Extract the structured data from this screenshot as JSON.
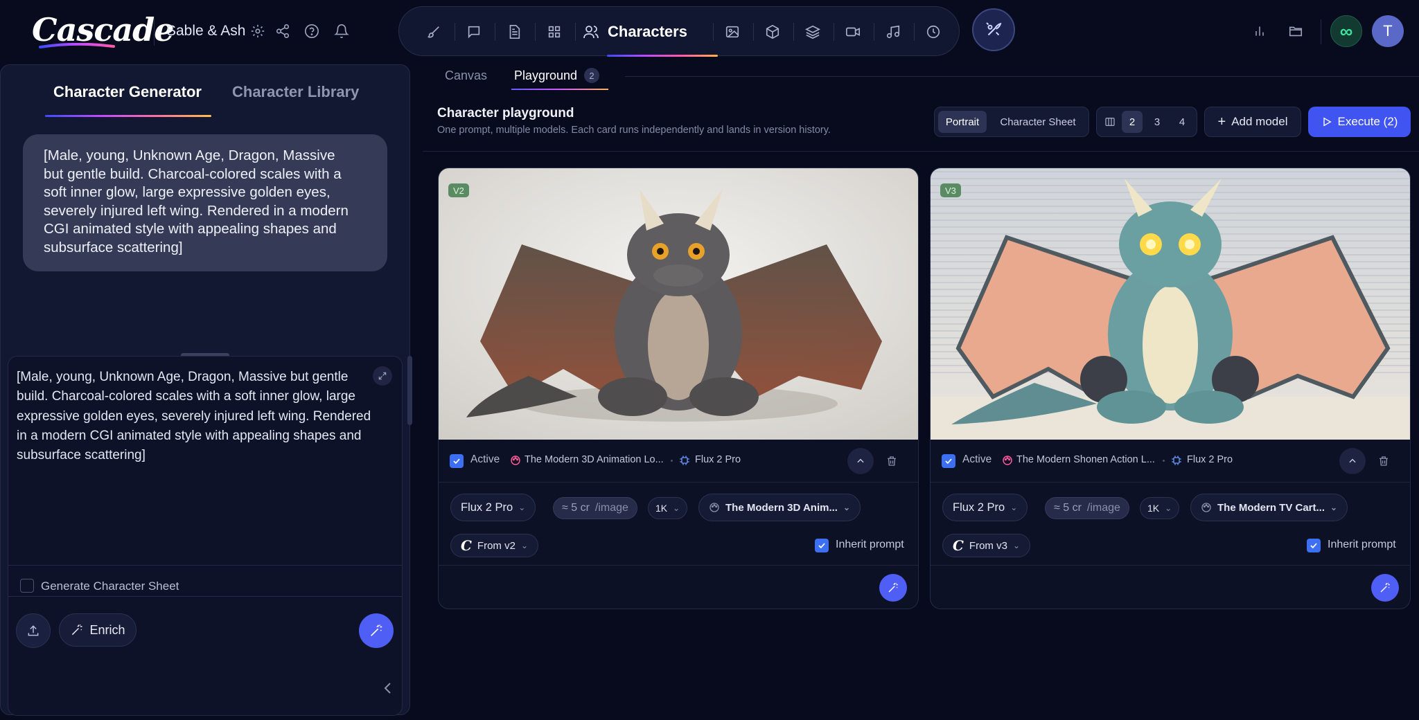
{
  "app": {
    "logo": "Cascade",
    "project_name": "Sable & Ash"
  },
  "nav": {
    "active_label": "Characters",
    "items": [
      "brush-icon",
      "chat-icon",
      "document-icon",
      "grid-icon",
      "users-icon",
      "image-icon",
      "cube-icon",
      "layers-icon",
      "video-icon",
      "music-icon",
      "history-icon"
    ]
  },
  "left_panel": {
    "tabs": [
      "Character Generator",
      "Character Library"
    ],
    "active_tab": 0,
    "bubble_lines": [
      "[Male, young, Unknown Age, Dragon, Massive",
      "but gentle build. Charcoal-colored scales with a",
      "soft inner glow, large expressive golden eyes,",
      "severely injured left wing. Rendered in a modern",
      "CGI animated style with appealing shapes and",
      "subsurface scattering]"
    ],
    "prompt_lines": [
      "[Male, young, Unknown Age, Dragon, Massive but gentle",
      "build. Charcoal-colored scales with a soft inner glow, large",
      "expressive golden eyes, severely injured left wing. Rendered",
      "in a modern CGI animated style with appealing shapes and",
      "subsurface scattering]"
    ],
    "generate_sheet_label": "Generate Character Sheet",
    "generate_sheet_checked": false,
    "enrich_label": "Enrich"
  },
  "playground": {
    "tabs": {
      "canvas": "Canvas",
      "playground": "Playground",
      "playground_badge": "2"
    },
    "title": "Character playground",
    "subtitle": "One prompt, multiple models. Each card runs independently and lands in version history.",
    "mode_options": [
      "Portrait",
      "Character Sheet"
    ],
    "mode_selected": "Portrait",
    "columns_options": [
      "2",
      "3",
      "4"
    ],
    "columns_selected": "2",
    "add_model_label": "Add model",
    "execute_label": "Execute (2)"
  },
  "cards": [
    {
      "version": "V2",
      "active_label": "Active",
      "active_checked": true,
      "style_name": "The Modern 3D Animation Lo...",
      "model_name": "Flux 2 Pro",
      "model_chip": "Flux 2 Pro",
      "cost_prefix": "≈ 5 cr",
      "cost_suffix": "/image",
      "resolution": "1K",
      "style_chip": "The Modern 3D Anim...",
      "from_label": "From v2",
      "inherit_label": "Inherit prompt",
      "inherit_checked": true
    },
    {
      "version": "V3",
      "active_label": "Active",
      "active_checked": true,
      "style_name": "The Modern Shonen Action L...",
      "model_name": "Flux 2 Pro",
      "model_chip": "Flux 2 Pro",
      "cost_prefix": "≈ 5 cr",
      "cost_suffix": "/image",
      "resolution": "1K",
      "style_chip": "The Modern TV Cart...",
      "from_label": "From v3",
      "inherit_label": "Inherit prompt",
      "inherit_checked": true
    }
  ],
  "colors": {
    "background": "#070b1d",
    "panel": "#121831",
    "accent": "#4f5ef5",
    "execute": "#3f54f0",
    "success": "#3fe0a0"
  },
  "user": {
    "avatar_initial": "T"
  }
}
